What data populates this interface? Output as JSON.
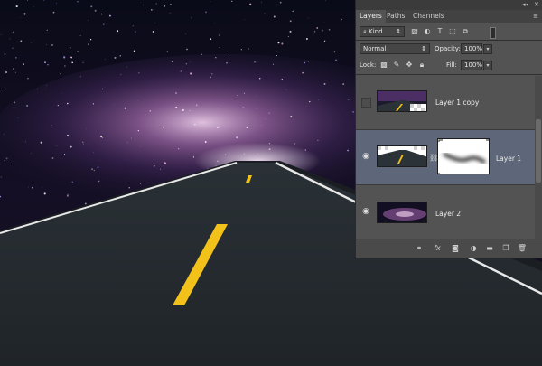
{
  "panel": {
    "collapse_glyph": "◂◂",
    "close_glyph": "✕",
    "tabs": [
      {
        "label": "Layers",
        "active": true
      },
      {
        "label": "Paths",
        "active": false
      },
      {
        "label": "Channels",
        "active": false
      }
    ],
    "menu_glyph": "≡",
    "filter": {
      "label": "Kind",
      "icon": "search-icon"
    },
    "blend_mode": "Normal",
    "opacity_label": "Opacity:",
    "opacity_value": "100%",
    "lock_label": "Lock:",
    "fill_label": "Fill:",
    "fill_value": "100%",
    "layers": [
      {
        "name": "Layer 1 copy",
        "visible": false,
        "selected": false,
        "has_mask": false
      },
      {
        "name": "Layer 1",
        "visible": true,
        "selected": true,
        "has_mask": true
      },
      {
        "name": "Layer 2",
        "visible": true,
        "selected": false,
        "has_mask": false
      }
    ],
    "bottom_icons": [
      "link-icon",
      "fx-icon",
      "add-mask-icon",
      "adjustment-icon",
      "folder-icon",
      "new-layer-icon",
      "trash-icon"
    ],
    "fx_label": "fx"
  },
  "colors": {
    "panel_bg": "#535353",
    "selected_row": "#5d6779",
    "road_line": "#f2c21a",
    "nebula": "#8a5a9a"
  }
}
